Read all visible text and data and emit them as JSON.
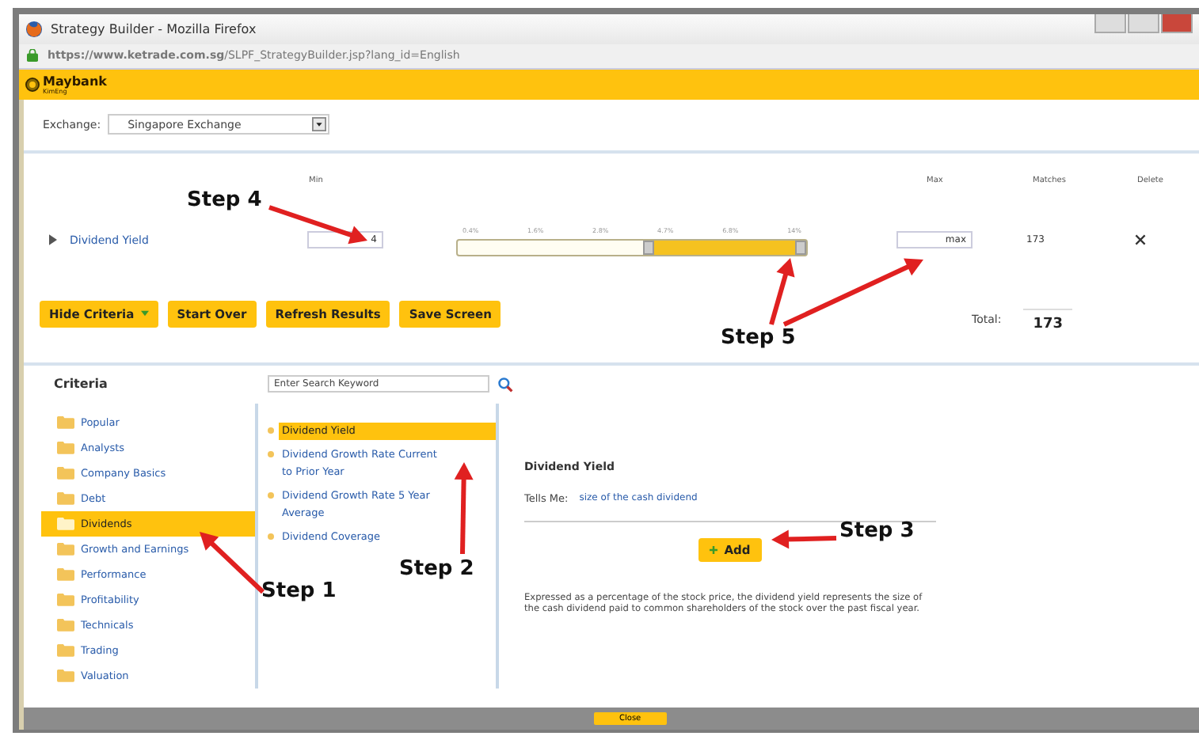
{
  "window": {
    "title": "Strategy Builder - Mozilla Firefox",
    "url_host": "https://www.ketrade.com.sg",
    "url_path": "/SLPF_StrategyBuilder.jsp?lang_id=English"
  },
  "brand": {
    "name": "Maybank",
    "sub": "KimEng"
  },
  "exchange": {
    "label": "Exchange:",
    "value": "Singapore Exchange"
  },
  "criteria_table": {
    "columns": [
      "Min",
      "Max",
      "Matches",
      "Delete"
    ],
    "rows": [
      {
        "name": "Dividend Yield",
        "min": "4",
        "max": "max",
        "matches": "173",
        "ticks": [
          "0.4%",
          "1.6%",
          "2.8%",
          "4.7%",
          "6.8%",
          "14%"
        ],
        "level": 0.45
      }
    ]
  },
  "buttons": [
    {
      "label": "Hide Criteria",
      "kind": "toggle"
    },
    {
      "label": "Start Over",
      "kind": "plain"
    },
    {
      "label": "Refresh Results",
      "kind": "plain"
    },
    {
      "label": "Save Screen",
      "kind": "plain"
    }
  ],
  "total": {
    "label": "Total:",
    "value": "173"
  },
  "criteria": {
    "title": "Criteria",
    "placeholder": "Enter Search Keyword",
    "categories": [
      {
        "label": "Popular",
        "selected": false
      },
      {
        "label": "Analysts",
        "selected": false
      },
      {
        "label": "Company Basics",
        "selected": false
      },
      {
        "label": "Debt",
        "selected": false
      },
      {
        "label": "Dividends",
        "selected": true
      },
      {
        "label": "Growth and Earnings",
        "selected": false
      },
      {
        "label": "Performance",
        "selected": false
      },
      {
        "label": "Profitability",
        "selected": false
      },
      {
        "label": "Technicals",
        "selected": false
      },
      {
        "label": "Trading",
        "selected": false
      },
      {
        "label": "Valuation",
        "selected": false
      }
    ],
    "items": [
      {
        "label": "Dividend Yield",
        "selected": true
      },
      {
        "label": "Dividend Growth Rate Current to Prior Year",
        "selected": false
      },
      {
        "label": "Dividend Growth Rate 5 Year Average",
        "selected": false
      },
      {
        "label": "Dividend Coverage",
        "selected": false
      }
    ]
  },
  "detail": {
    "title": "Dividend Yield",
    "tells_label": "Tells Me:",
    "tells_value": "size of the cash dividend",
    "add": "Add",
    "description": "Expressed as a percentage of the stock price, the dividend yield represents the size of the cash dividend paid to common shareholders of the stock over the past fiscal year."
  },
  "footer": {
    "close": "Close"
  },
  "annotations": [
    {
      "label": "Step 4"
    },
    {
      "label": "Step 5"
    },
    {
      "label": "Step 1"
    },
    {
      "label": "Step 2"
    },
    {
      "label": "Step 3"
    }
  ]
}
